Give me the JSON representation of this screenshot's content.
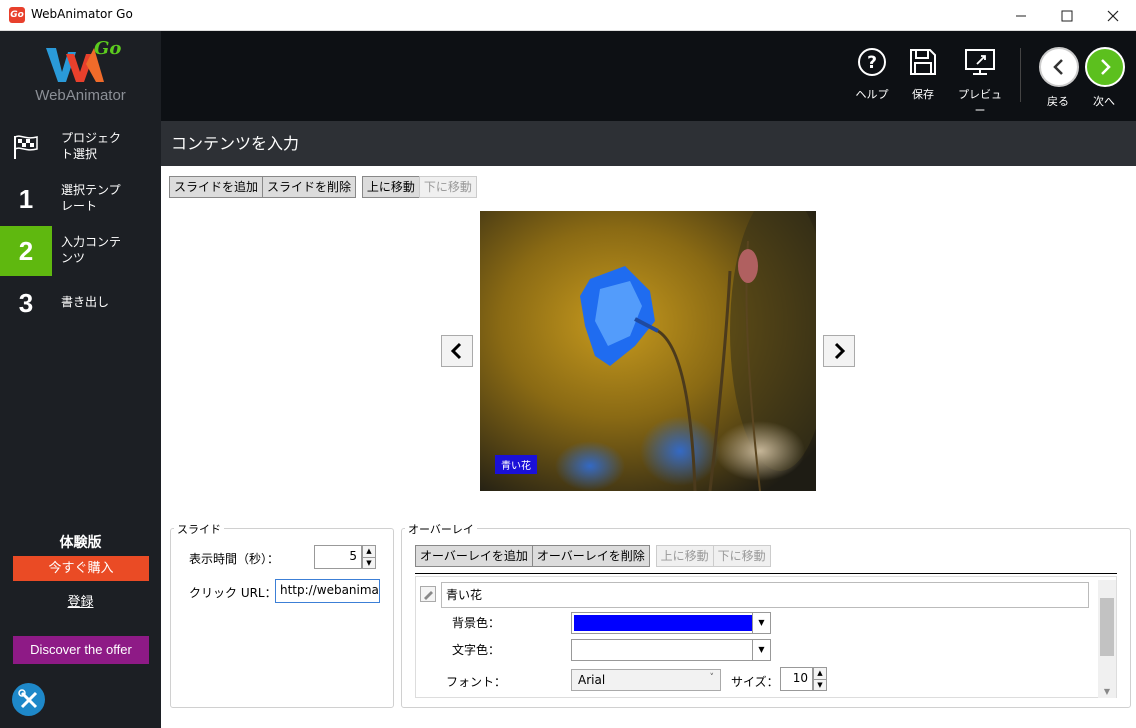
{
  "window": {
    "title": "WebAnimator Go",
    "icon_text": "Go"
  },
  "sidebar": {
    "logo_go": "Go",
    "logo_text": "WebAnimator",
    "steps": [
      {
        "num": "",
        "label": "プロジェクト選択"
      },
      {
        "num": "1",
        "label": "選択テンプレート"
      },
      {
        "num": "2",
        "label": "入力コンテンツ"
      },
      {
        "num": "3",
        "label": "書き出し"
      }
    ],
    "trial_label": "体験版",
    "buy_label": "今すぐ購入",
    "register_label": "登録",
    "offer_label": "Discover the offer"
  },
  "toolbar": {
    "help_label": "ヘルプ",
    "save_label": "保存",
    "preview_label": "プレビュー",
    "back_label": "戻る",
    "next_label": "次へ"
  },
  "page": {
    "title": "コンテンツを入力"
  },
  "slide_toolbar": {
    "add_slide": "スライドを追加",
    "delete_slide": "スライドを削除",
    "move_up": "上に移動",
    "move_down": "下に移動"
  },
  "preview": {
    "caption": "青い花"
  },
  "slide_panel": {
    "legend": "スライド",
    "duration_label": "表示時間（秒）：",
    "duration_value": "5",
    "url_label": "クリック URL：",
    "url_value": "http://webanimator"
  },
  "overlay_panel": {
    "legend": "オーバーレイ",
    "add_overlay": "オーバーレイを追加",
    "delete_overlay": "オーバーレイを削除",
    "move_up": "上に移動",
    "move_down": "下に移動",
    "text_value": "青い花",
    "bg_color_label": "背景色：",
    "bg_color": "#0000ff",
    "text_color_label": "文字色：",
    "text_color": "#ffffff",
    "font_label": "フォント：",
    "font_value": "Arial",
    "size_label": "サイズ：",
    "size_value": "10"
  }
}
